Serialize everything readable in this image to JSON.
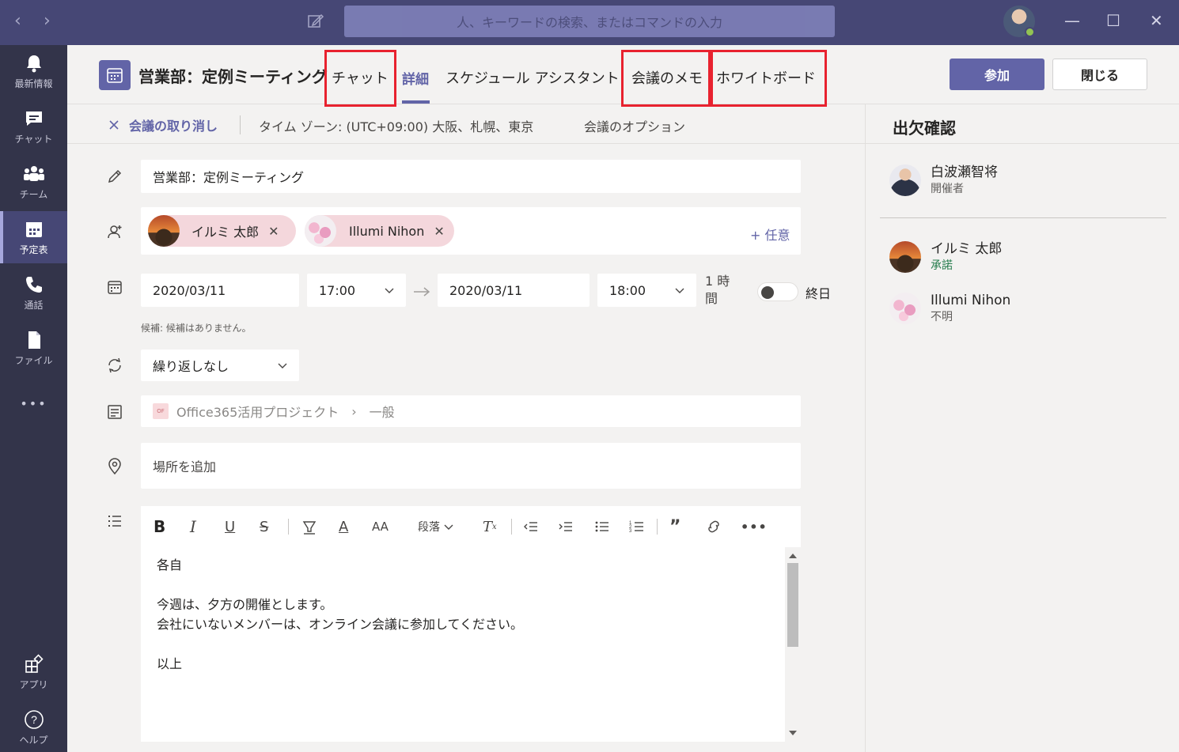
{
  "titlebar": {
    "search_placeholder": "人、キーワードの検索、またはコマンドの入力",
    "back_glyph": "‹",
    "forward_glyph": "›",
    "minimize_glyph": "—",
    "maximize_glyph": "☐",
    "close_glyph": "✕"
  },
  "rail": {
    "items": [
      {
        "label": "最新情報",
        "icon": "bell-icon"
      },
      {
        "label": "チャット",
        "icon": "chat-icon"
      },
      {
        "label": "チーム",
        "icon": "teams-icon"
      },
      {
        "label": "予定表",
        "icon": "calendar-icon"
      },
      {
        "label": "通話",
        "icon": "phone-icon"
      },
      {
        "label": "ファイル",
        "icon": "file-icon"
      }
    ],
    "more": "•••",
    "apps": "アプリ",
    "help": "ヘルプ"
  },
  "header": {
    "title": "営業部：定例ミーティング",
    "tabs": [
      {
        "label": "チャット"
      },
      {
        "label": "詳細"
      },
      {
        "label": "スケジュール アシスタント"
      },
      {
        "label": "会議のメモ"
      },
      {
        "label": "ホワイトボード"
      }
    ],
    "join": "参加",
    "close": "閉じる"
  },
  "subbar": {
    "cancel": "会議の取り消し",
    "timezone": "タイム ゾーン: (UTC+09:00) 大阪、札幌、東京",
    "options": "会議のオプション"
  },
  "form": {
    "title_value": "営業部：定例ミーティング",
    "attendees": [
      {
        "name": "イルミ 太郎"
      },
      {
        "name": "Illumi Nihon"
      }
    ],
    "optional": "+ 任意",
    "start_date": "2020/03/11",
    "start_time": "17:00",
    "end_date": "2020/03/11",
    "end_time": "18:00",
    "duration": "1 時間",
    "allday": "終日",
    "suggestion": "候補: 候補はありません。",
    "repeat": "繰り返しなし",
    "channel_badge": "OF",
    "channel": "Office365活用プロジェクト",
    "channel_sub": "一般",
    "location_placeholder": "場所を追加",
    "paragraph": "段落"
  },
  "editor": {
    "lines": [
      "各自",
      "",
      "今週は、夕方の開催とします。",
      "会社にいないメンバーは、オンライン会議に参加してください。",
      "",
      "以上"
    ]
  },
  "attendance": {
    "title": "出欠確認",
    "people": [
      {
        "name": "白波瀬智将",
        "status": "開催者"
      },
      {
        "name": "イルミ 太郎",
        "status": "承諾"
      },
      {
        "name": "Illumi Nihon",
        "status": "不明"
      }
    ]
  },
  "colors": {
    "accent": "#6264a7",
    "titlebar": "#464775",
    "rail": "#33344a",
    "highlight": "#e8222f"
  }
}
